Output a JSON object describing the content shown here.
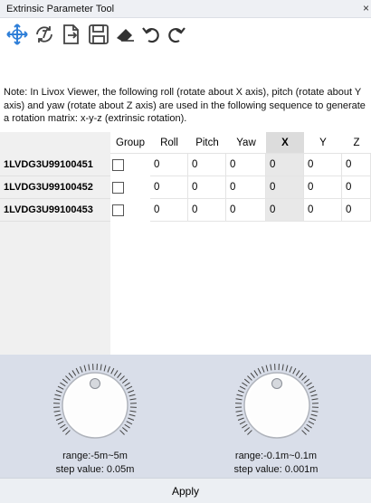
{
  "window": {
    "title": "Extrinsic Parameter Tool",
    "close_label": "×"
  },
  "toolbar": {
    "icons": [
      "move-axes-icon",
      "refresh-icon",
      "import-file-icon",
      "save-icon",
      "eraser-icon",
      "undo-icon",
      "redo-icon"
    ],
    "accent_color": "#2f7fd8"
  },
  "note": "Note: In Livox Viewer, the following roll (rotate about X axis), pitch (rotate about Y axis) and yaw (rotate about Z axis) are used in the following sequence to generate a rotation matrix: x-y-z (extrinsic rotation).",
  "table": {
    "columns": [
      "Group",
      "Roll",
      "Pitch",
      "Yaw",
      "X",
      "Y",
      "Z"
    ],
    "active_column": "X",
    "rows": [
      {
        "name": "1LVDG3U99100451",
        "group": false,
        "values": [
          "0",
          "0",
          "0",
          "0",
          "0",
          "0"
        ]
      },
      {
        "name": "1LVDG3U99100452",
        "group": false,
        "values": [
          "0",
          "0",
          "0",
          "0",
          "0",
          "0"
        ]
      },
      {
        "name": "1LVDG3U99100453",
        "group": false,
        "values": [
          "0",
          "0",
          "0",
          "0",
          "0",
          "0"
        ]
      }
    ]
  },
  "controls": {
    "translation_knob": {
      "range": "range:-5m~5m",
      "step": "step value: 0.05m"
    },
    "fine_knob": {
      "range": "range:-0.1m~0.1m",
      "step": "step value: 0.001m"
    },
    "apply_label": "Apply"
  }
}
